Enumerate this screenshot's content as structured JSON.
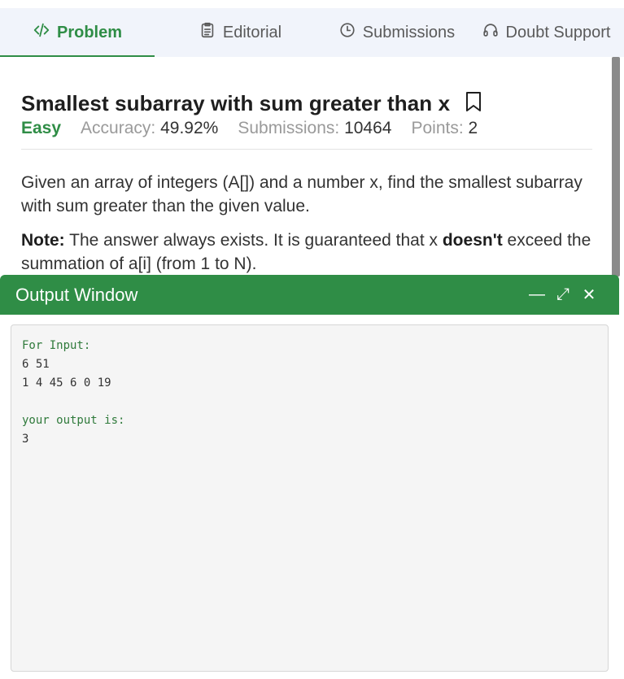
{
  "tabs": [
    {
      "label": "Problem",
      "icon": "code-icon",
      "active": true
    },
    {
      "label": "Editorial",
      "icon": "document-icon",
      "active": false
    },
    {
      "label": "Submissions",
      "icon": "clock-icon",
      "active": false
    },
    {
      "label": "Doubt Support",
      "icon": "headset-icon",
      "active": false
    }
  ],
  "problem": {
    "title": "Smallest subarray with sum greater than x",
    "difficulty": "Easy",
    "accuracy_label": "Accuracy:",
    "accuracy_value": "49.92%",
    "submissions_label": "Submissions:",
    "submissions_value": "10464",
    "points_label": "Points:",
    "points_value": "2",
    "description": "Given an array of integers (A[])  and a number x, find the smallest subarray with sum greater than the given value.",
    "note_label": "Note:",
    "note_text_1": " The answer always exists. It is guaranteed that x ",
    "note_bold": "doesn't",
    "note_text_2": " exceed the summation of a[i] (from 1 to N)."
  },
  "output_window": {
    "title": "Output Window",
    "minimize_glyph": "—",
    "expand_glyph": "⤢",
    "close_glyph": "✕",
    "console_lines": [
      {
        "text": "For Input:",
        "style": "green"
      },
      {
        "text": "6 51",
        "style": "normal"
      },
      {
        "text": "1 4 45 6 0 19",
        "style": "normal"
      },
      {
        "text": "",
        "style": "normal"
      },
      {
        "text": "your output is:",
        "style": "green"
      },
      {
        "text": "3",
        "style": "normal"
      }
    ]
  },
  "colors": {
    "accent": "#2f8d46",
    "tab_bg": "#f1f4fb"
  }
}
